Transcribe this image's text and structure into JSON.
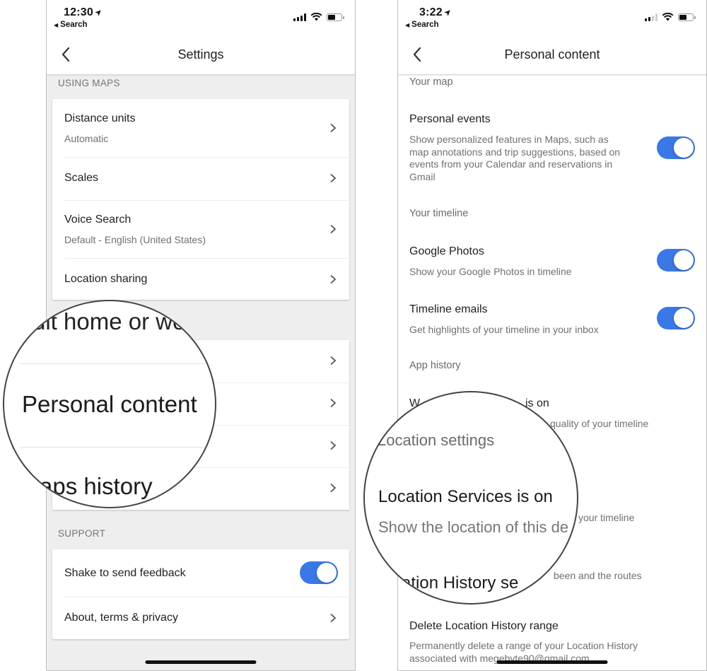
{
  "left_screen": {
    "status_bar": {
      "time": "12:30",
      "back_app": "Search"
    },
    "nav": {
      "title": "Settings",
      "back_icon": "chevron-left-icon"
    },
    "sections": [
      {
        "label": "USING MAPS",
        "items": [
          {
            "title": "Distance units",
            "subtitle": "Automatic",
            "control": "chevron"
          },
          {
            "title": "Scales",
            "control": "chevron"
          },
          {
            "title": "Voice Search",
            "subtitle": "Default - English (United States)",
            "control": "chevron"
          },
          {
            "title": "Location sharing",
            "control": "chevron"
          }
        ]
      },
      {
        "label": "Edit home or work",
        "items": [
          {
            "title": "",
            "control": "chevron"
          },
          {
            "title": "Personal content",
            "control": "chevron"
          },
          {
            "title": "",
            "control": "chevron"
          },
          {
            "title": "Maps history",
            "control": "chevron"
          }
        ]
      },
      {
        "label": "SUPPORT",
        "items": [
          {
            "title": "Shake to send feedback",
            "control": "toggle",
            "on": true
          },
          {
            "title": "About, terms & privacy",
            "control": "chevron"
          }
        ]
      }
    ],
    "magnifier": {
      "text_top": "dit home or wo",
      "text_main": "Personal content",
      "text_bottom": "aps history"
    }
  },
  "right_screen": {
    "status_bar": {
      "time": "3:22",
      "back_app": "Search"
    },
    "nav": {
      "title": "Personal content",
      "back_icon": "chevron-left-icon"
    },
    "content": {
      "your_map_label": "Your map",
      "personal_events": {
        "title": "Personal events",
        "subtitle_lines": [
          "Show personalized features in Maps, such as",
          "map annotations and trip suggestions, based on",
          "events from your Calendar and reservations in",
          "Gmail"
        ],
        "on": true
      },
      "your_timeline_label": "Your timeline",
      "google_photos": {
        "title": "Google Photos",
        "subtitle": "Show your Google Photos in timeline",
        "on": true
      },
      "timeline_emails": {
        "title": "Timeline emails",
        "subtitle": "Get highlights of your timeline in your inbox",
        "on": true
      },
      "app_history_label": "App history",
      "web_app_activity": {
        "title_visible_start": "W",
        "title_visible_end": "is on",
        "subtitle_visible": "quality of your timeline"
      },
      "location_services_sub_visible": "your timeline",
      "location_history_sub_visible": "been and the routes",
      "delete_range": {
        "title": "Delete Location History range",
        "subtitle_lines": [
          "Permanently delete a range of your Location History",
          "associated with megebyte90@gmail.com"
        ]
      }
    },
    "magnifier": {
      "section": "Location settings",
      "title": "Location Services is on",
      "subtitle": "Show the location of this de",
      "bottom": "ation History se"
    }
  },
  "colors": {
    "toggle_on": "#3b78e7",
    "page_bg": "#eeeeee",
    "text_primary": "#202124",
    "text_secondary": "#707070"
  }
}
